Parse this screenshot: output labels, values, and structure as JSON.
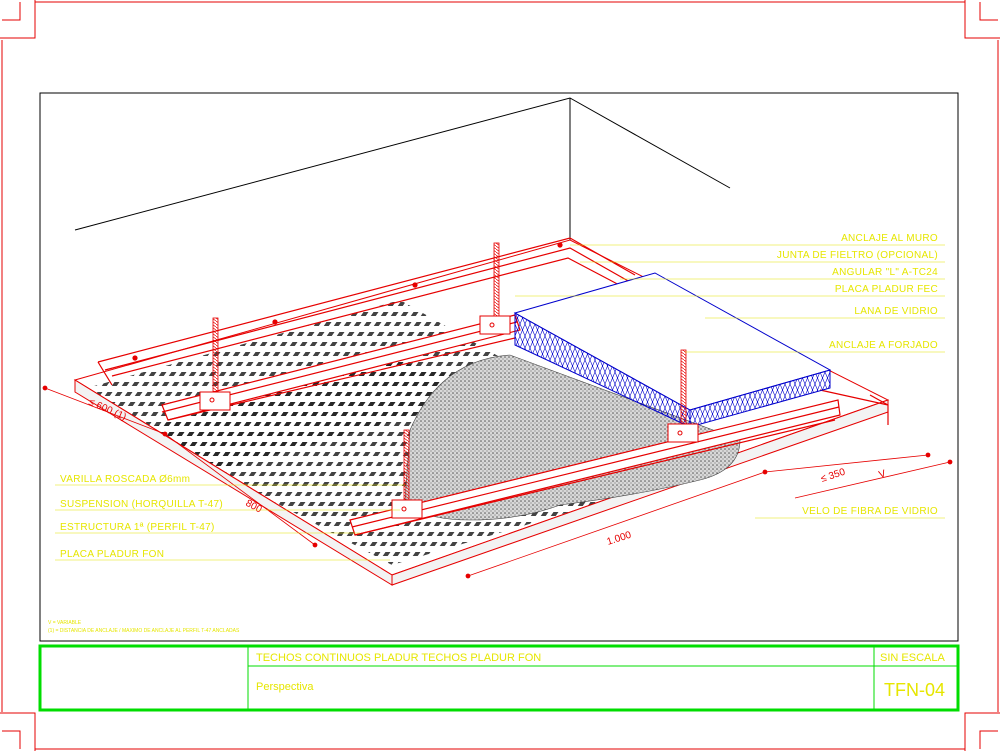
{
  "labels_right": [
    "ANCLAJE AL MURO",
    "JUNTA DE FIELTRO (OPCIONAL)",
    "ANGULAR \"L\" A-TC24",
    "PLACA PLADUR FEC",
    "LANA DE VIDRIO",
    "ANCLAJE A FORJADO"
  ],
  "label_velo": "VELO DE FIBRA DE VIDRIO",
  "labels_left": [
    "VARILLA ROSCADA Ø6mm",
    "SUSPENSION (HORQUILLA T-47)",
    "ESTRUCTURA 1ª (PERFIL T-47)",
    "PLACA PLADUR FON"
  ],
  "dimensions": {
    "d600": "≤ 600 (1)",
    "d800": "800",
    "d1000": "1.000",
    "d350": "≤ 350",
    "dV": "V"
  },
  "notes": [
    "V = VARIABLE",
    "(1) = DISTANCIA DE ANCLAJE / MAXIMO DE ANCLAJE AL PERFIL T-47 ANCLADAS"
  ],
  "title_block": {
    "title": "TECHOS CONTINUOS PLADUR  TECHOS PLADUR  FON",
    "subtitle": "Perspectiva",
    "scale": "SIN ESCALA",
    "code": "TFN-04"
  },
  "colors": {
    "label": "#e6e600",
    "structure": "#e60000",
    "insulation": "#0000cc",
    "frame": "#00dd00",
    "outline": "#000000"
  }
}
